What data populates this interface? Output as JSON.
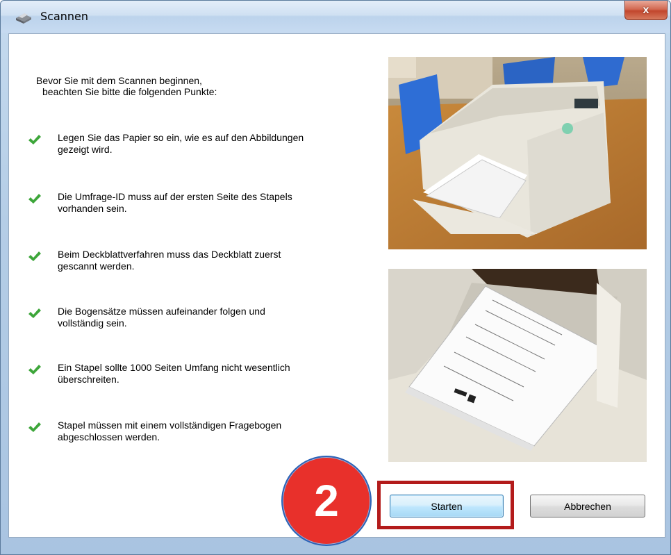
{
  "window": {
    "title": "Scannen",
    "close_label": "x"
  },
  "intro": {
    "line1": "Bevor Sie mit dem Scannen beginnen,",
    "line2": "beachten Sie bitte die folgenden Punkte:"
  },
  "checklist": [
    {
      "line1": "Legen Sie das Papier so ein, wie es auf den Abbildungen",
      "line2": "gezeigt wird."
    },
    {
      "line1": "Die Umfrage-ID muss auf der ersten Seite des Stapels",
      "line2": "vorhanden sein."
    },
    {
      "line1": "Beim Deckblattverfahren muss das Deckblatt zuerst",
      "line2": "gescannt werden."
    },
    {
      "line1": "Die Bogensätze müssen aufeinander folgen und",
      "line2": "vollständig sein."
    },
    {
      "line1": "Ein Stapel sollte 1000 Seiten Umfang nicht wesentlich",
      "line2": "überschreiten."
    },
    {
      "line1": "Stapel müssen mit einem vollständigen Fragebogen",
      "line2": "abgeschlossen werden."
    }
  ],
  "buttons": {
    "start_label": "Starten",
    "cancel_label": "Abbrechen"
  },
  "annotation": {
    "step_number": "2"
  },
  "colors": {
    "check": "#3da63a",
    "badge": "#e8302b",
    "highlight": "#b31b1b"
  }
}
